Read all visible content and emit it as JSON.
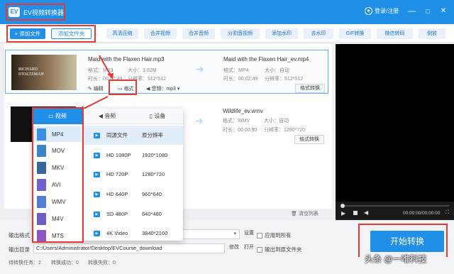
{
  "app": {
    "title": "EV视频转换器",
    "logo_text": "EV",
    "user_label": "登录/注册",
    "min": "—",
    "max": "□",
    "close": "✕"
  },
  "toolbar": {
    "add_file": "+ 添加文件",
    "add_folder": "添加文件夹",
    "tools": [
      "高清压缩",
      "合并视频",
      "合并音频",
      "分割音视频",
      "添加水印",
      "去水印",
      "GIF转换",
      "微信转码",
      "倒放"
    ]
  },
  "items": [
    {
      "thumb_text": "RICHARD STOLTZMAN",
      "src_name": "Maid with the Flaxen Hair.mp3",
      "src_format_label": "格式：",
      "src_format": "MP3",
      "src_size_label": "大小：",
      "src_size": "3.92M",
      "src_dur_label": "时长：",
      "src_dur": "00:02:49",
      "src_res_label": "分辨率：",
      "src_res": "512*512",
      "dst_name": "Maid with the Flaxen Hair_ev.mp4",
      "dst_format_label": "格式：",
      "dst_format": "MP4",
      "dst_size_label": "大小：",
      "dst_size": "自动",
      "dst_dur_label": "时长：",
      "dst_dur": "00:02:49",
      "dst_res_label": "分辨率：",
      "dst_res": "512*512",
      "edit": "编辑",
      "format_btn": "格式",
      "audio": "音频：mp3",
      "convert_fmt": "格式转换"
    },
    {
      "dst_name": "Wildlife_ev.wmv",
      "dst_format_label": "格式：",
      "dst_format": "WMV",
      "dst_size_label": "大小：",
      "dst_size": "自动",
      "dst_dur_label": "时长：",
      "dst_dur": "00:00:30",
      "dst_res_label": "分辨率：",
      "dst_res": "1280*720",
      "convert_fmt": "格式转换"
    }
  ],
  "dropdown": {
    "tabs": [
      "视频",
      "音频",
      "设备"
    ],
    "formats": [
      {
        "name": "MP4",
        "color": "#3b8fe0"
      },
      {
        "name": "MOV",
        "color": "#3f84c9"
      },
      {
        "name": "MKV",
        "color": "#37689c"
      },
      {
        "name": "AVI",
        "color": "#6e63c7"
      },
      {
        "name": "WMV",
        "color": "#4f7fd1"
      },
      {
        "name": "M4V",
        "color": "#6c5fc0"
      },
      {
        "name": "MTS",
        "color": "#8a58c0"
      }
    ],
    "presets": [
      {
        "name": "同源文件",
        "res": "原分辨率"
      },
      {
        "name": "HD 1080P",
        "res": "1920*1080"
      },
      {
        "name": "HD 720P",
        "res": "1280*720"
      },
      {
        "name": "HD 640P",
        "res": "960*640"
      },
      {
        "name": "SD 480P",
        "res": "640*480"
      },
      {
        "name": "4K Video",
        "res": "3840*2160"
      }
    ]
  },
  "player": {
    "time": "00:00:00/00:00:00"
  },
  "bottom": {
    "clear_list": "清空列表",
    "output_format_label": "输出格式",
    "settings": "设置",
    "apply_all": "应用到所有",
    "output_dir_label": "输出目录",
    "output_dir": "C:/Users/Administrator/Desktop/EVCourse_download",
    "modify": "修改",
    "open": "打开",
    "output_to_source": "输出到原文件夹",
    "start": "开始转换"
  },
  "status": {
    "waiting": "待转换任务：2",
    "success": "转换成功：0",
    "failed": "转换失败：0"
  },
  "watermark": "头条 @一唯科技"
}
